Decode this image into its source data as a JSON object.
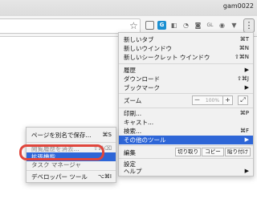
{
  "window": {
    "profile_name": "gam0022"
  },
  "toolbar": {
    "icons": [
      "star-icon",
      "extension-icon",
      "extension-icon",
      "extension-icon",
      "camera-icon",
      "extension-icon",
      "extension-icon",
      "extension-icon",
      "menu-icon"
    ],
    "ext_labels": [
      "",
      "G",
      "",
      "",
      "",
      "GL",
      "",
      ""
    ],
    "menu_glyph": "⋮",
    "star_glyph": "☆"
  },
  "menu": {
    "new_tab": {
      "label": "新しいタブ",
      "shortcut": "⌘T"
    },
    "new_window": {
      "label": "新しいウインドウ",
      "shortcut": "⌘N"
    },
    "new_incognito": {
      "label": "新しいシークレット ウインドウ",
      "shortcut": "⇧⌘N"
    },
    "history": {
      "label": "履歴",
      "arrow": "▶"
    },
    "downloads": {
      "label": "ダウンロード",
      "shortcut": "⇧⌘J"
    },
    "bookmarks": {
      "label": "ブックマーク",
      "arrow": "▶"
    },
    "zoom": {
      "label": "ズーム",
      "minus": "－",
      "value": "100%",
      "plus": "+",
      "fullscreen": "⤢"
    },
    "print": {
      "label": "印刷...",
      "shortcut": "⌘P"
    },
    "cast": {
      "label": "キャスト..."
    },
    "find": {
      "label": "検索...",
      "shortcut": "⌘F"
    },
    "more_tools": {
      "label": "その他のツール",
      "arrow": "▶"
    },
    "edit": {
      "label": "編集",
      "cut": "切り取り",
      "copy": "コピー",
      "paste": "貼り付け"
    },
    "settings": {
      "label": "設定"
    },
    "help": {
      "label": "ヘルプ",
      "arrow": "▶"
    }
  },
  "submenu": {
    "save_page": {
      "label": "ページを別名で保存...",
      "shortcut": "⌘S"
    },
    "clear_data": {
      "label": "閲覧履歴を消去...",
      "shortcut": "⇧⌘⌫"
    },
    "extensions": {
      "label": "拡張機能"
    },
    "task_manager": {
      "label": "タスク マネージャ"
    },
    "dev_tools": {
      "label": "デベロッパー ツール",
      "shortcut": "⌥⌘I"
    }
  },
  "colors": {
    "selection": "#2e66d7",
    "highlight_ring": "#e0463c"
  }
}
